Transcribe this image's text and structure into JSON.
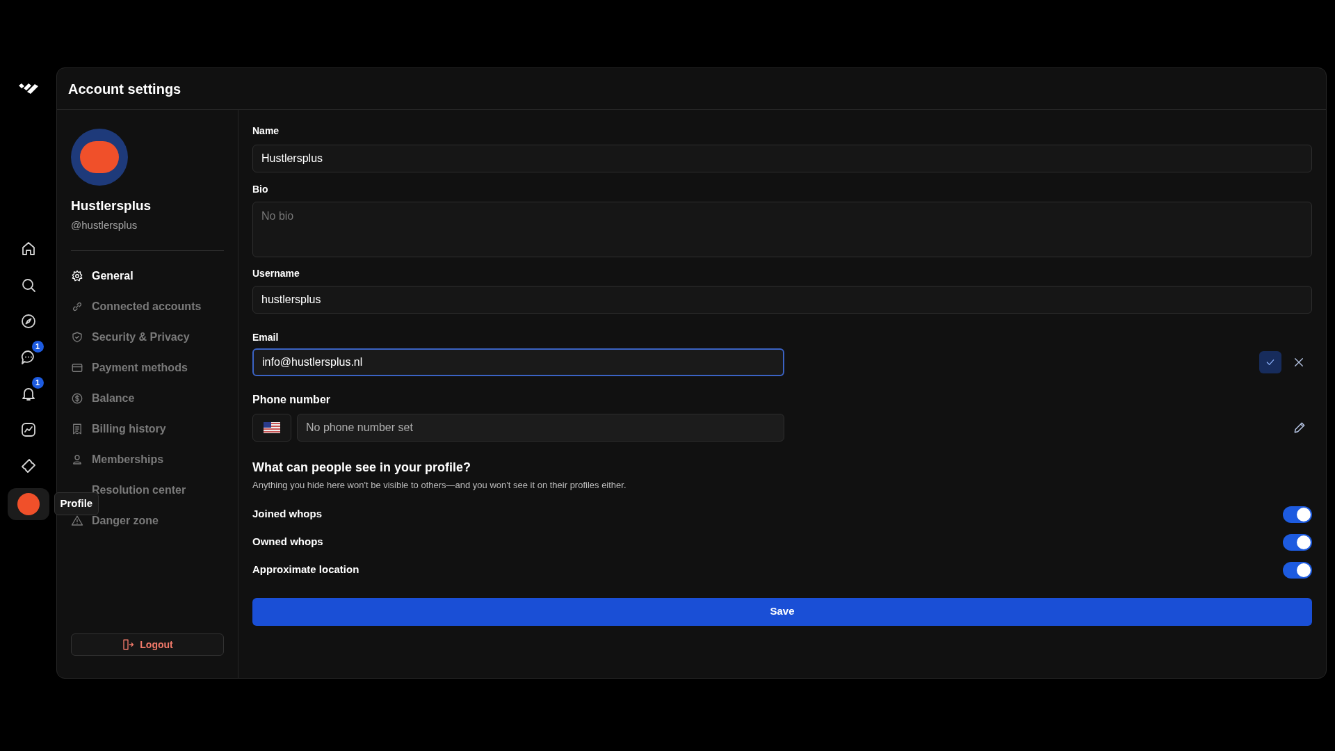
{
  "rail": {
    "items": [
      {
        "kind": "home"
      },
      {
        "kind": "search"
      },
      {
        "kind": "compass"
      },
      {
        "kind": "chat",
        "badge": "1"
      },
      {
        "kind": "bell",
        "badge": "1"
      },
      {
        "kind": "chart"
      },
      {
        "kind": "ticket"
      },
      {
        "kind": "avatar",
        "selected": true,
        "tooltip": "Profile"
      }
    ]
  },
  "header": {
    "title": "Account settings"
  },
  "profile": {
    "name": "Hustlersplus",
    "handle": "@hustlersplus"
  },
  "sidebar": {
    "items": [
      {
        "label": "General",
        "selected": true
      },
      {
        "label": "Connected accounts",
        "selected": false
      },
      {
        "label": "Security & Privacy",
        "selected": false
      },
      {
        "label": "Payment methods",
        "selected": false
      },
      {
        "label": "Balance",
        "selected": false
      },
      {
        "label": "Billing history",
        "selected": false
      },
      {
        "label": "Memberships",
        "selected": false
      },
      {
        "label": "Resolution center",
        "selected": false
      },
      {
        "label": "Danger zone",
        "selected": false
      }
    ],
    "logout": "Logout"
  },
  "form": {
    "name": {
      "label": "Name",
      "value": "Hustlersplus"
    },
    "bio": {
      "label": "Bio",
      "placeholder": "No bio"
    },
    "username": {
      "label": "Username",
      "value": "hustlersplus"
    },
    "email": {
      "label": "Email",
      "value": "info@hustlersplus.nl",
      "editing": true
    },
    "phone": {
      "label": "Phone number",
      "placeholder": "No phone number set"
    },
    "privacy": {
      "title": "What can people see in your profile?",
      "subtitle": "Anything you hide here won't be visible to others—and you won't see it on their profiles either.",
      "toggles": [
        {
          "label": "Joined whops",
          "on": true
        },
        {
          "label": "Owned whops",
          "on": true
        },
        {
          "label": "Approximate location",
          "on": true
        }
      ]
    },
    "save": "Save"
  }
}
